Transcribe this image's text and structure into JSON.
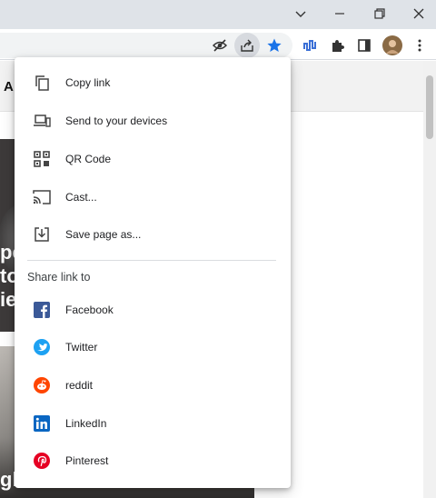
{
  "window": {
    "controls": [
      "chevron-down",
      "minimize",
      "restore",
      "close"
    ]
  },
  "toolbar": {
    "icons": [
      "eye-off-icon",
      "share-icon",
      "bookmark-star-icon",
      "extension-chart-icon",
      "puzzle-icon",
      "side-panel-icon",
      "avatar",
      "more-icon"
    ],
    "star_color": "#1a73e8"
  },
  "page": {
    "header_letter": "A",
    "card1_lines": [
      "pe",
      "to",
      "ie"
    ],
    "card2_text": "gl"
  },
  "menu": {
    "items": [
      {
        "label": "Copy link",
        "icon": "copy-link-icon"
      },
      {
        "label": "Send to your devices",
        "icon": "send-to-devices-icon"
      },
      {
        "label": "QR Code",
        "icon": "qr-code-icon"
      },
      {
        "label": "Cast...",
        "icon": "cast-icon"
      },
      {
        "label": "Save page as...",
        "icon": "save-page-icon"
      }
    ],
    "share_heading": "Share link to",
    "share_items": [
      {
        "label": "Facebook",
        "icon": "facebook-icon",
        "color": "#3b5998"
      },
      {
        "label": "Twitter",
        "icon": "twitter-icon",
        "color": "#1da1f2"
      },
      {
        "label": "reddit",
        "icon": "reddit-icon",
        "color": "#ff4500"
      },
      {
        "label": "LinkedIn",
        "icon": "linkedin-icon",
        "color": "#0a66c2"
      },
      {
        "label": "Pinterest",
        "icon": "pinterest-icon",
        "color": "#e60023"
      }
    ]
  }
}
